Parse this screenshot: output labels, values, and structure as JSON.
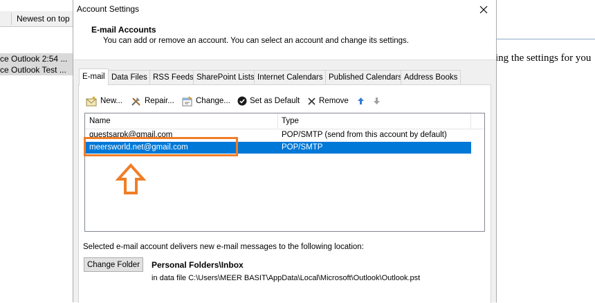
{
  "background": {
    "sort_label": "Newest on top",
    "rows": [
      "ce Outlook  2:54 ...",
      "ce Outlook Test ..."
    ],
    "text_fragment": "ing the settings for you"
  },
  "dialog": {
    "title": "Account Settings",
    "header_title": "E-mail Accounts",
    "header_desc": "You can add or remove an account. You can select an account and change its settings.",
    "tabs": [
      {
        "label": "E-mail",
        "active": true
      },
      {
        "label": "Data Files"
      },
      {
        "label": "RSS Feeds"
      },
      {
        "label": "SharePoint Lists"
      },
      {
        "label": "Internet Calendars"
      },
      {
        "label": "Published Calendars"
      },
      {
        "label": "Address Books"
      }
    ],
    "toolbar": {
      "new_label": "New...",
      "repair_label": "Repair...",
      "change_label": "Change...",
      "default_label": "Set as Default",
      "remove_label": "Remove"
    },
    "list": {
      "columns": [
        "Name",
        "Type"
      ],
      "rows": [
        {
          "name": "guestsarpk@gmail.com",
          "type": "POP/SMTP (send from this account by default)"
        },
        {
          "name": "meersworld.net@gmail.com",
          "type": "POP/SMTP",
          "selected": true
        }
      ]
    },
    "deliver_label": "Selected e-mail account delivers new e-mail messages to the following location:",
    "change_folder_label": "Change Folder",
    "folder_title": "Personal Folders\\Inbox",
    "folder_path": "in data file C:\\Users\\MEER BASIT\\AppData\\Local\\Microsoft\\Outlook\\Outlook.pst"
  },
  "colors": {
    "selection": "#0078d7",
    "highlight": "#f07d27",
    "arrow_blue": "#2e7bd6"
  }
}
